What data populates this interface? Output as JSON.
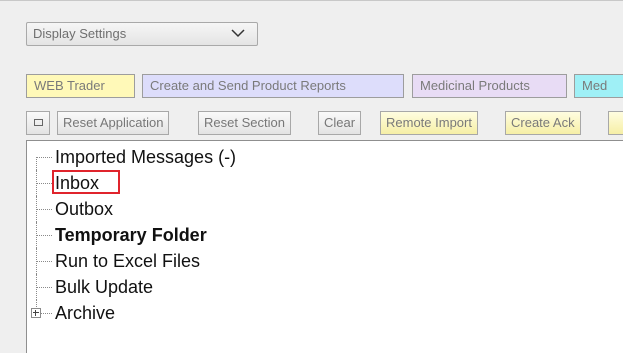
{
  "display_settings": {
    "label": "Display Settings",
    "icon": "chevron-down-icon"
  },
  "tabs": [
    {
      "label": "WEB Trader",
      "bg": "#fff9b8"
    },
    {
      "label": "Create and Send Product Reports",
      "bg": "#ddddfb"
    },
    {
      "label": "Medicinal Products",
      "bg": "#e8dcf5"
    },
    {
      "label": "Med",
      "bg": "#9ff0f6"
    }
  ],
  "toolbar": {
    "collapse_icon": "square-icon",
    "reset_application": "Reset Application",
    "reset_section": "Reset Section",
    "clear": "Clear",
    "remote_import": "Remote Import",
    "create_ack": "Create Ack"
  },
  "tree": {
    "items": [
      {
        "label": "Imported Messages (-)",
        "bold": false
      },
      {
        "label": "Inbox",
        "bold": false,
        "highlighted": true
      },
      {
        "label": "Outbox",
        "bold": false
      },
      {
        "label": "Temporary Folder",
        "bold": true
      },
      {
        "label": "Run to Excel Files",
        "bold": false
      },
      {
        "label": "Bulk Update",
        "bold": false
      },
      {
        "label": "Archive",
        "bold": false,
        "expandable": true
      }
    ],
    "highlight_color": "#e0242c"
  }
}
